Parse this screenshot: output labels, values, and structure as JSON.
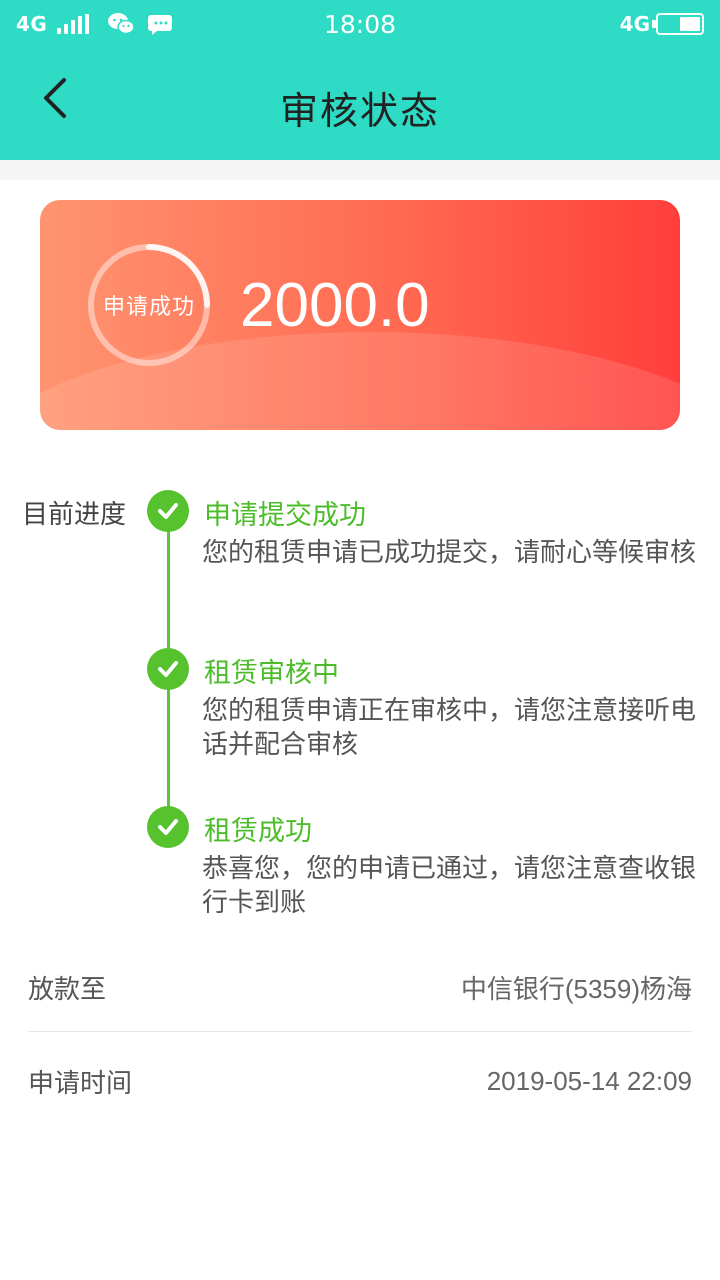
{
  "status_bar": {
    "network_left": "4G",
    "time": "18:08",
    "network_right": "4G"
  },
  "header": {
    "title": "审核状态",
    "back_icon": "chevron-left-icon"
  },
  "card": {
    "status_label": "申请成功",
    "amount": "2000.0",
    "gradient_start": "#ff9470",
    "gradient_end": "#ff3e3b"
  },
  "progress": {
    "label": "目前进度",
    "steps": [
      {
        "title": "申请提交成功",
        "desc": "您的租赁申请已成功提交，请耐心等候审核"
      },
      {
        "title": "租赁审核中",
        "desc": "您的租赁申请正在审核中，请您注意接听电话并配合审核"
      },
      {
        "title": "租赁成功",
        "desc": "恭喜您，您的申请已通过，请您注意查收银行卡到账"
      }
    ],
    "accent": "#55c22e"
  },
  "info": {
    "payout_label": "放款至",
    "payout_value": "中信银行(5359)杨海",
    "time_label": "申请时间",
    "time_value": "2019-05-14 22:09"
  },
  "colors": {
    "header_bg": "#2edcc6"
  }
}
